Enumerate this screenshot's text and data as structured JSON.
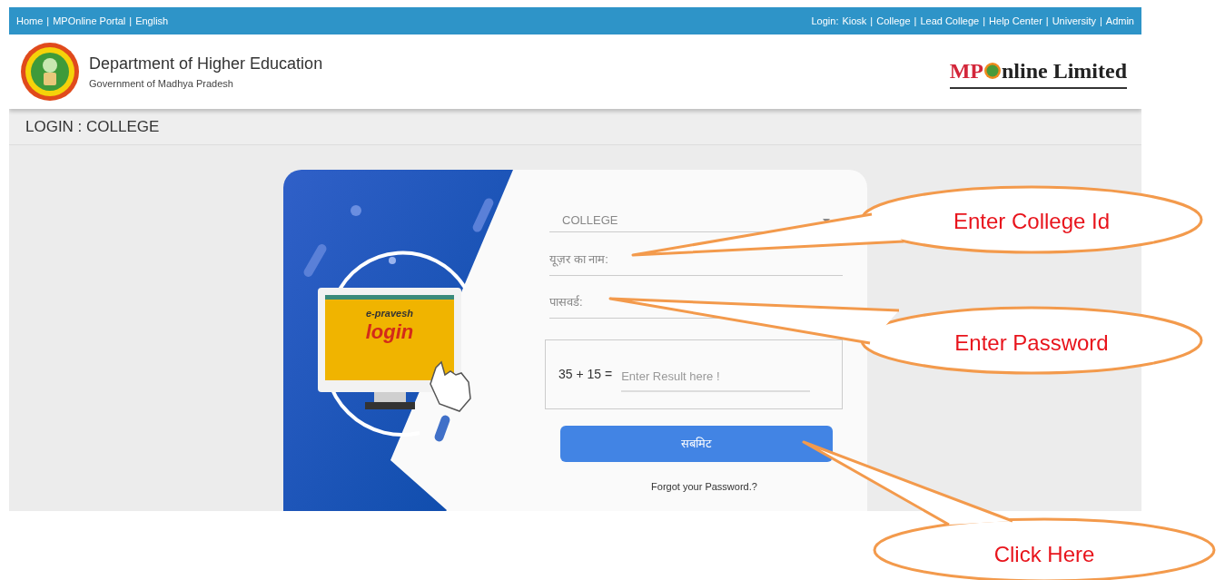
{
  "top_bar": {
    "separator": "|",
    "left_links": [
      "Home",
      "MPOnline Portal",
      "English"
    ],
    "login_label": "Login:",
    "right_links": [
      "Kiosk",
      "College",
      "Lead College",
      "Help Center",
      "University",
      "Admin"
    ]
  },
  "header": {
    "title": "Department of Higher Education",
    "subtitle": "Government of Madhya Pradesh",
    "brand_left": "MP",
    "brand_right": "nline Limited"
  },
  "page_title": "LOGIN : COLLEGE",
  "illustration": {
    "screen_line1": "e-pravesh",
    "screen_line2": "login"
  },
  "form": {
    "role_select": "COLLEGE",
    "username_placeholder": "यूज़र का नाम:",
    "password_placeholder": "पासवर्ड:",
    "captcha": "35 + 15 =",
    "captcha_placeholder": "Enter Result here !",
    "submit": "सबमिट",
    "forgot": "Forgot your Password.?"
  },
  "callouts": [
    {
      "text": "Enter College Id"
    },
    {
      "text": "Enter Password"
    },
    {
      "text": "Click Here"
    }
  ]
}
